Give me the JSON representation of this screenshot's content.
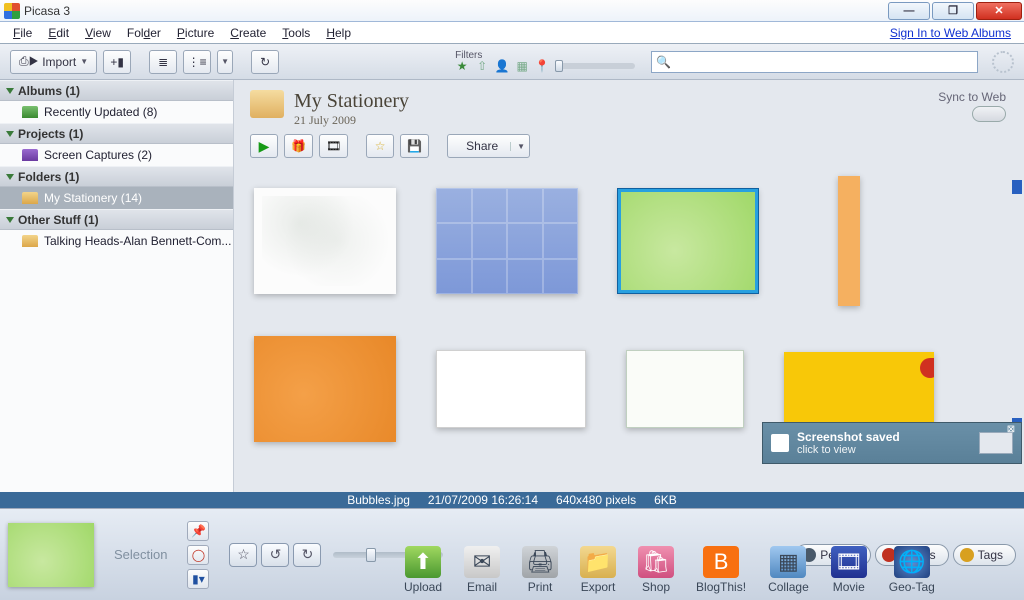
{
  "window": {
    "title": "Picasa 3"
  },
  "menu": [
    "File",
    "Edit",
    "View",
    "Folder",
    "Picture",
    "Create",
    "Tools",
    "Help"
  ],
  "signin_link": "Sign In to Web Albums",
  "toolbar": {
    "import": "Import",
    "filters_label": "Filters"
  },
  "sidebar": {
    "sections": [
      {
        "label": "Albums (1)",
        "items": [
          {
            "label": "Recently Updated (8)",
            "icon": "green"
          }
        ]
      },
      {
        "label": "Projects (1)",
        "items": [
          {
            "label": "Screen Captures (2)",
            "icon": "purple"
          }
        ]
      },
      {
        "label": "Folders (1)",
        "items": [
          {
            "label": "My Stationery (14)",
            "icon": "folder",
            "selected": true
          }
        ]
      },
      {
        "label": "Other Stuff (1)",
        "items": [
          {
            "label": "Talking Heads-Alan Bennett-Com...",
            "icon": "folder"
          }
        ]
      }
    ]
  },
  "folder": {
    "name": "My Stationery",
    "date": "21 July 2009",
    "sync_label": "Sync to Web",
    "share_label": "Share"
  },
  "status": {
    "filename": "Bubbles.jpg",
    "datetime": "21/07/2009 16:26:14",
    "dimensions": "640x480 pixels",
    "size": "6KB"
  },
  "notification": {
    "title": "Screenshot saved",
    "subtitle": "click to view"
  },
  "tray": {
    "selection": "Selection",
    "pills": [
      {
        "label": "People",
        "color": "#4a5a6a"
      },
      {
        "label": "Places",
        "color": "#c03020"
      },
      {
        "label": "Tags",
        "color": "#d8a020"
      }
    ],
    "actions": [
      "Upload",
      "Email",
      "Print",
      "Export",
      "Shop",
      "BlogThis!",
      "Collage",
      "Movie",
      "Geo-Tag"
    ]
  }
}
